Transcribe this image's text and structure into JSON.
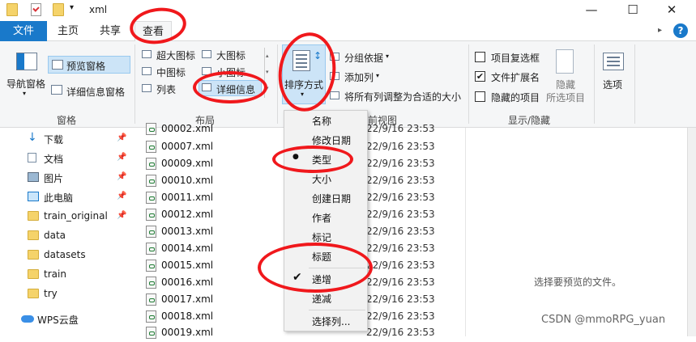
{
  "window": {
    "title": "xml",
    "quick_access_dropdown": "▾"
  },
  "tabs": [
    "文件",
    "主页",
    "共享",
    "查看"
  ],
  "ribbon": {
    "panes": {
      "nav_pane": "导航窗格",
      "preview_pane": "预览窗格",
      "details_pane": "详细信息窗格",
      "group": "窗格"
    },
    "layout": {
      "extra_large": "超大图标",
      "large": "大图标",
      "medium": "中图标",
      "small": "小图标",
      "list": "列表",
      "details": "详细信息",
      "group": "布局"
    },
    "current_view": {
      "sort_by": "排序方式",
      "group_by": "分组依据",
      "add_column": "添加列",
      "fit_columns": "将所有列调整为合适的大小",
      "group": "前视图"
    },
    "show_hide": {
      "item_checkboxes": "项目复选框",
      "file_extensions": "文件扩展名",
      "hidden_items": "隐藏的项目",
      "hide": "隐藏",
      "selected_items": "所选项目",
      "group": "显示/隐藏"
    },
    "options": "选项"
  },
  "checkboxes": {
    "item_checkboxes": false,
    "file_extensions": true,
    "hidden_items": false
  },
  "nav": [
    {
      "label": "下载",
      "icon": "download-icon",
      "pinned": true
    },
    {
      "label": "文档",
      "icon": "document-icon",
      "pinned": true
    },
    {
      "label": "图片",
      "icon": "picture-icon",
      "pinned": true
    },
    {
      "label": "此电脑",
      "icon": "computer-icon",
      "pinned": true
    },
    {
      "label": "train_original",
      "icon": "folder-icon",
      "pinned": true
    },
    {
      "label": "data",
      "icon": "folder-icon",
      "pinned": false
    },
    {
      "label": "datasets",
      "icon": "folder-icon",
      "pinned": false
    },
    {
      "label": "train",
      "icon": "folder-icon",
      "pinned": false
    },
    {
      "label": "try",
      "icon": "folder-icon",
      "pinned": false
    },
    {
      "label": "WPS云盘",
      "icon": "cloud-icon",
      "pinned": false
    }
  ],
  "files": [
    {
      "name": "00002.xml",
      "date": "22/9/16 23:53"
    },
    {
      "name": "00007.xml",
      "date": "22/9/16 23:53"
    },
    {
      "name": "00009.xml",
      "date": "22/9/16 23:53"
    },
    {
      "name": "00010.xml",
      "date": "22/9/16 23:53"
    },
    {
      "name": "00011.xml",
      "date": "22/9/16 23:53"
    },
    {
      "name": "00012.xml",
      "date": "22/9/16 23:53"
    },
    {
      "name": "00013.xml",
      "date": "22/9/16 23:53"
    },
    {
      "name": "00014.xml",
      "date": "22/9/16 23:53"
    },
    {
      "name": "00015.xml",
      "date": "22/9/16 23:53"
    },
    {
      "name": "00016.xml",
      "date": "22/9/16 23:53"
    },
    {
      "name": "00017.xml",
      "date": "22/9/16 23:53"
    },
    {
      "name": "00018.xml",
      "date": "22/9/16 23:53"
    },
    {
      "name": "00019.xml",
      "date": "22/9/16 23:53"
    }
  ],
  "sort_menu": {
    "items": [
      "名称",
      "修改日期",
      "类型",
      "大小",
      "创建日期",
      "作者",
      "标记",
      "标题",
      "递增",
      "递减",
      "选择列..."
    ],
    "selected_field": "类型",
    "selected_order": "递增",
    "marks": {
      "bullet": "●",
      "check": "✔"
    }
  },
  "preview": {
    "empty_text": "选择要预览的文件。"
  },
  "watermark": "CSDN @mmoRPG_yuan",
  "colors": {
    "file_tab": "#1979ca",
    "annotation": "#f0181c",
    "selection": "#cce4f7"
  }
}
